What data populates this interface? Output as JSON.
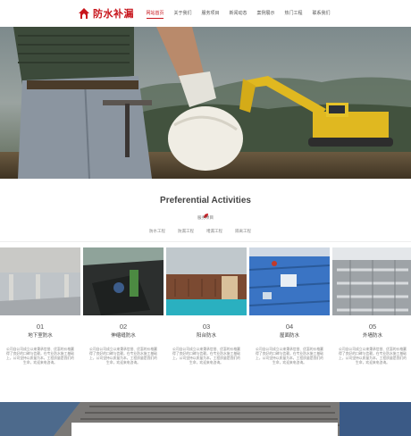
{
  "header": {
    "logo_text": "防水补漏",
    "nav": [
      "网站首页",
      "关于我们",
      "服务项目",
      "新闻动态",
      "案例展示",
      "热门工程",
      "联系我们"
    ]
  },
  "section": {
    "title": "Preferential Activities",
    "subtitle": "服务项目",
    "tabs": [
      "防水工程",
      "防漏工程",
      "堵漏工程",
      "隔离工程"
    ]
  },
  "cards": [
    {
      "num": "01",
      "name": "地下室防水",
      "desc": "公司自公司成立以来秉承信誉、优惠的价格赢得了良好的口碑与信赖，在专业防水施工基础上，公司坚持以质量为本，工程质量是我们的生命，欢迎来电咨询。"
    },
    {
      "num": "02",
      "name": "伸缩缝防水",
      "desc": "公司自公司成立以来秉承信誉、优惠的价格赢得了良好的口碑与信赖，在专业防水施工基础上，公司坚持以质量为本，工程质量是我们的生命，欢迎来电咨询。"
    },
    {
      "num": "03",
      "name": "阳台防水",
      "desc": "公司自公司成立以来秉承信誉、优惠的价格赢得了良好的口碑与信赖，在专业防水施工基础上，公司坚持以质量为本，工程质量是我们的生命，欢迎来电咨询。"
    },
    {
      "num": "04",
      "name": "屋面防水",
      "desc": "公司自公司成立以来秉承信誉、优惠的价格赢得了良好的口碑与信赖，在专业防水施工基础上，公司坚持以质量为本，工程质量是我们的生命，欢迎来电咨询。"
    },
    {
      "num": "05",
      "name": "外墙防水",
      "desc": "公司自公司成立以来秉承信誉、优惠的价格赢得了良好的口碑与信赖，在专业防水施工基础上，公司坚持以质量为本，工程质量是我们的生命，欢迎来电咨询。"
    }
  ],
  "colors": {
    "brand": "#c8161d",
    "text": "#444444",
    "muted": "#888888"
  },
  "icons": {
    "logo": "house-roof-icon",
    "section": "leaf-icon"
  }
}
